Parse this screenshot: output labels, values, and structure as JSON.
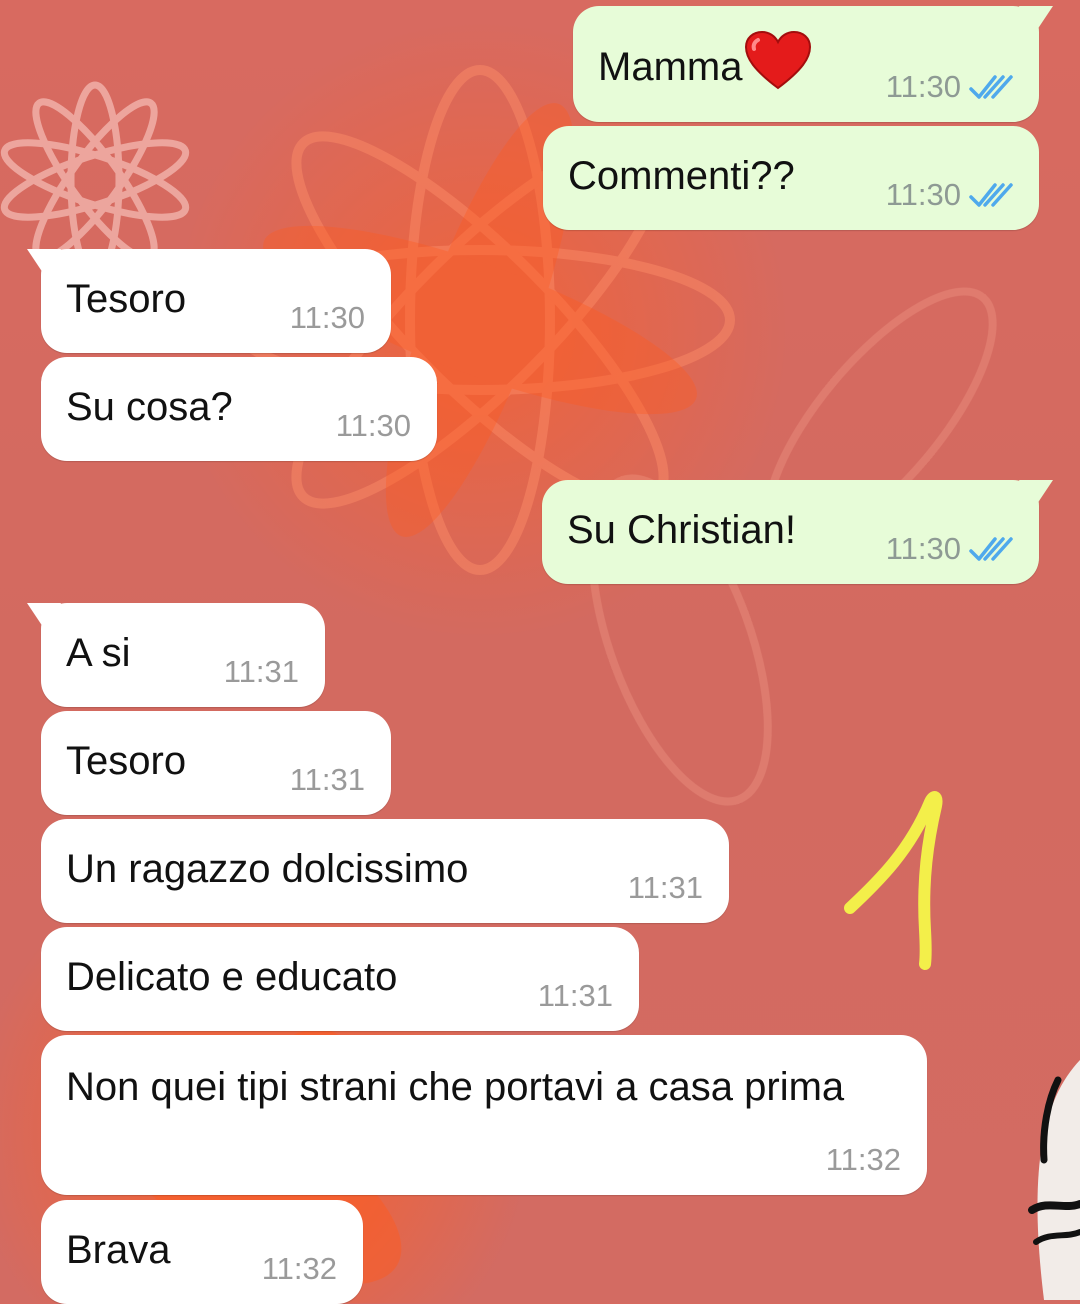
{
  "messages": [
    {
      "direction": "out",
      "text": "Mamma",
      "emoji": "red-heart",
      "time": "11:30",
      "status": "read"
    },
    {
      "direction": "out",
      "text": "Commenti??",
      "time": "11:30",
      "status": "read"
    },
    {
      "direction": "in",
      "text": "Tesoro",
      "time": "11:30"
    },
    {
      "direction": "in",
      "text": "Su cosa?",
      "time": "11:30"
    },
    {
      "direction": "out",
      "text": "Su Christian!",
      "time": "11:30",
      "status": "read"
    },
    {
      "direction": "in",
      "text": "A si",
      "time": "11:31"
    },
    {
      "direction": "in",
      "text": "Tesoro",
      "time": "11:31"
    },
    {
      "direction": "in",
      "text": "Un ragazzo dolcissimo",
      "time": "11:31"
    },
    {
      "direction": "in",
      "text": "Delicato e educato",
      "time": "11:31"
    },
    {
      "direction": "in",
      "text": "Non quei tipi strani che portavi a casa prima",
      "time": "11:32"
    },
    {
      "direction": "in",
      "text": "Brava",
      "time": "11:32"
    }
  ],
  "annotation": {
    "icon": "handwritten-number-1",
    "color": "#f3ef4a"
  },
  "colors": {
    "outgoing_bubble": "#e7fcd8",
    "incoming_bubble": "#ffffff",
    "read_ticks": "#4fa9ec",
    "timestamp": "#8e9a94",
    "wallpaper": "#d76a5f"
  }
}
